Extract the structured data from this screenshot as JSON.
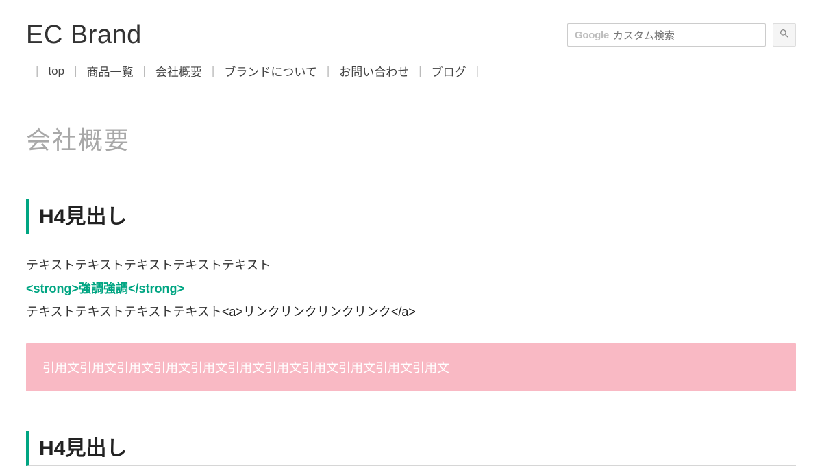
{
  "header": {
    "brand": "EC Brand",
    "search": {
      "google_logo": "Google",
      "placeholder": "カスタム検索"
    }
  },
  "nav": {
    "items": [
      "top",
      "商品一覧",
      "会社概要",
      "ブランドについて",
      "お問い合わせ",
      "ブログ"
    ]
  },
  "page": {
    "title": "会社概要"
  },
  "section1": {
    "heading": "H4見出し",
    "line1": "テキストテキストテキストテキストテキスト",
    "strong_demo": "<strong>強調強調</strong>",
    "line3_prefix": "テキストテキストテキストテキスト",
    "link_demo": "<a>リンクリンクリンクリンク</a>",
    "quote": "引用文引用文引用文引用文引用文引用文引用文引用文引用文引用文引用文"
  },
  "section2": {
    "heading": "H4見出し"
  },
  "colors": {
    "accent": "#00a582",
    "quote_bg": "#f9b9c4",
    "title_muted": "#a8a8a8"
  }
}
